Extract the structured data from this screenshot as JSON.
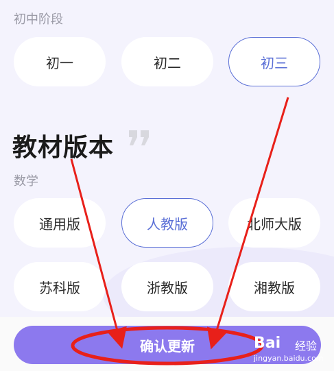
{
  "junior_high": {
    "label": "初中阶段",
    "grades": [
      "初一",
      "初二",
      "初三"
    ],
    "selected": "初三"
  },
  "textbook": {
    "title": "教材版本",
    "subject": "数学",
    "editions": [
      "通用版",
      "人教版",
      "北师大版",
      "苏科版",
      "浙教版",
      "湘教版"
    ],
    "selected": "人教版"
  },
  "confirm_label": "确认更新",
  "watermark": {
    "logo": "Bai",
    "text": "经验",
    "url": "jingyan.baidu.com"
  },
  "colors": {
    "accent": "#5a6fd6",
    "button": "#8c79ee",
    "annotation": "#e8201a",
    "background": "#f4f3fd"
  }
}
